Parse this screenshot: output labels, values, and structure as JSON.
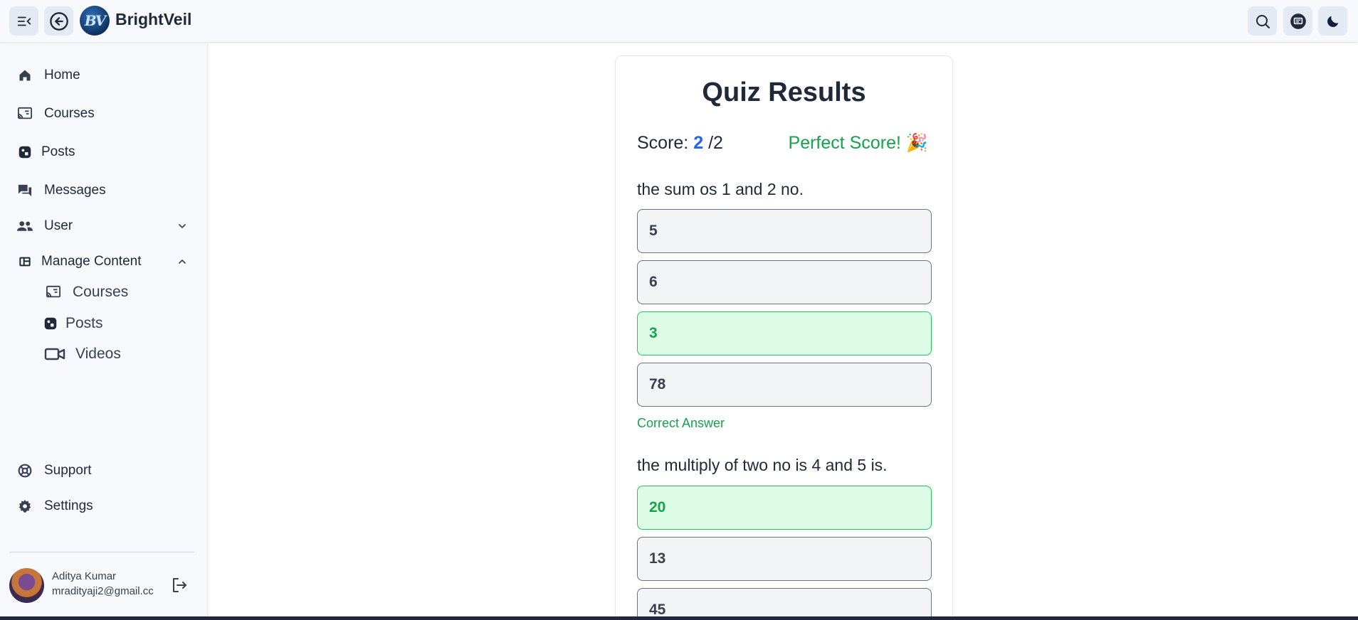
{
  "app": {
    "brand": "BrightVeil",
    "logo_text": "BV"
  },
  "sidebar": {
    "items": [
      {
        "label": "Home",
        "icon": "home-icon"
      },
      {
        "label": "Courses",
        "icon": "cast-icon"
      },
      {
        "label": "Posts",
        "icon": "posts-icon"
      },
      {
        "label": "Messages",
        "icon": "messages-icon"
      },
      {
        "label": "User",
        "icon": "users-icon"
      },
      {
        "label": "Manage Content",
        "icon": "manage-icon"
      }
    ],
    "sub_items": [
      {
        "label": "Courses",
        "icon": "cast-icon"
      },
      {
        "label": "Posts",
        "icon": "posts-icon"
      },
      {
        "label": "Videos",
        "icon": "video-icon"
      }
    ],
    "bottom_items": [
      {
        "label": "Support",
        "icon": "lifebuoy-icon"
      },
      {
        "label": "Settings",
        "icon": "gear-icon"
      }
    ],
    "user": {
      "name": "Aditya Kumar",
      "email": "mradityaji2@gmail.cc"
    }
  },
  "quiz": {
    "title": "Quiz Results",
    "score_label": "Score:",
    "score": "2",
    "total": "/2",
    "perfect": "Perfect Score! 🎉",
    "questions": [
      {
        "text": "the sum os 1 and 2 no.",
        "options": [
          "5",
          "6",
          "3",
          "78"
        ],
        "correct_index": 2,
        "feedback": "Correct Answer"
      },
      {
        "text": "the multiply of two no is 4 and 5 is.",
        "options": [
          "20",
          "13",
          "45"
        ],
        "correct_index": 0
      }
    ]
  },
  "colors": {
    "accent": "#2563eb",
    "success": "#16a34a",
    "success_bg": "#dcfce7"
  }
}
